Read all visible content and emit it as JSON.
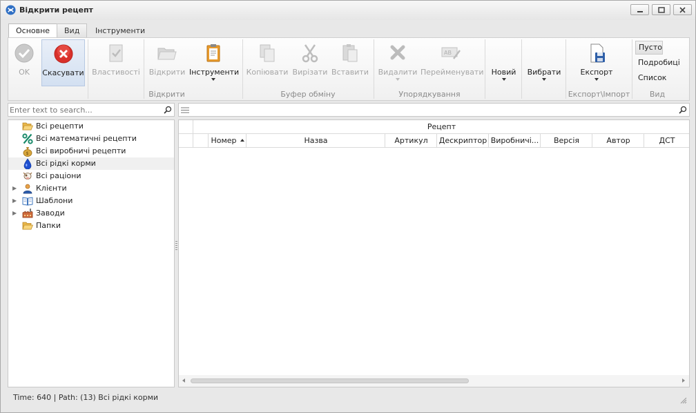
{
  "window": {
    "title": "Відкрити рецепт"
  },
  "tabs": [
    "Основне",
    "Вид",
    "Інструменти"
  ],
  "ribbon": {
    "buttons": {
      "ok": "OK",
      "cancel": "Скасувати",
      "properties": "Властивості",
      "open": "Відкрити",
      "tools": "Інструменти",
      "copy": "Копіювати",
      "cut": "Вирізати",
      "paste": "Вставити",
      "delete": "Видалити",
      "rename": "Перейменувати",
      "new": "Новий",
      "select": "Вибрати",
      "export": "Експорт"
    },
    "groups": {
      "open": "Відкрити",
      "clipboard": "Буфер обміну",
      "arrange": "Упорядкування",
      "export_import": "Експорт\\Імпорт",
      "view": "Вид"
    },
    "view_options": [
      "Пусто",
      "Подробиці",
      "Список"
    ],
    "view_selected": "Пусто"
  },
  "search": {
    "placeholder": "Enter text to search..."
  },
  "tree": {
    "items": [
      {
        "label": "Всі рецепти",
        "icon": "folder-open-icon"
      },
      {
        "label": "Всі математичні рецепти",
        "icon": "percent-icon"
      },
      {
        "label": "Всі виробничі рецепти",
        "icon": "money-bag-icon"
      },
      {
        "label": "Всі рідкі корми",
        "icon": "water-drop-icon"
      },
      {
        "label": "Всі раціони",
        "icon": "cow-icon"
      },
      {
        "label": "Клієнти",
        "icon": "user-icon"
      },
      {
        "label": "Шаблони",
        "icon": "book-icon"
      },
      {
        "label": "Заводи",
        "icon": "factory-icon"
      },
      {
        "label": "Папки",
        "icon": "folder-open-icon"
      }
    ],
    "selected": "Всі рідкі корми"
  },
  "grid": {
    "band": "Рецепт",
    "columns": [
      "Номер",
      "Назва",
      "Артикул",
      "Дескриптор",
      "Виробничі...",
      "Версія",
      "Автор",
      "ДСТ"
    ]
  },
  "status": {
    "text": "Time: 640 | Path: (13) Всі рідкі корми"
  },
  "colors": {
    "cancel_red": "#d9312b",
    "selection_blue": "#d3e0f1",
    "disabled_text": "#a5a5a5"
  }
}
